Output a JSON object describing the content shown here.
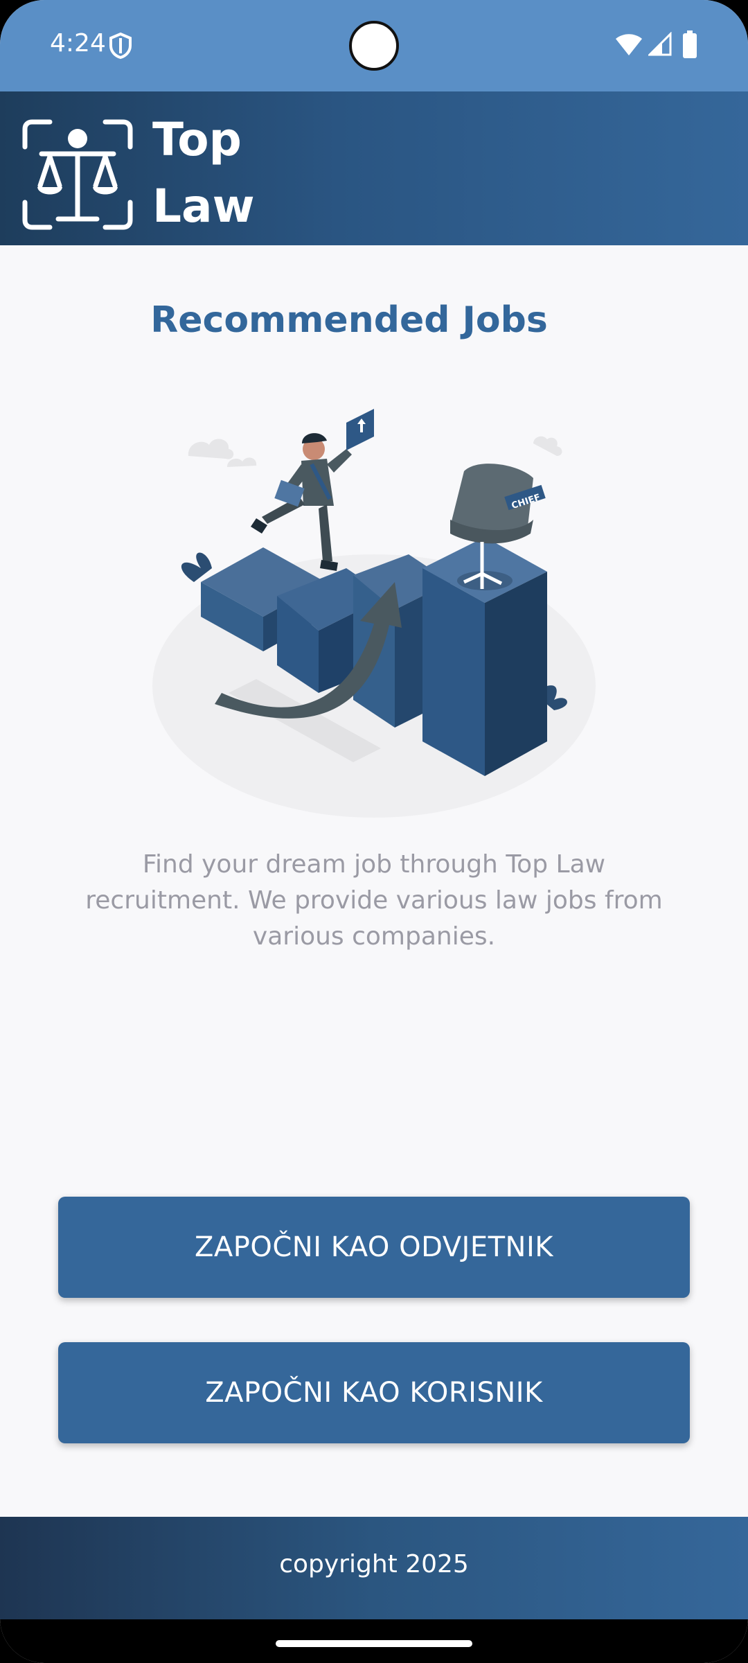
{
  "status_bar": {
    "time": "4:24",
    "icons": [
      "shield-icon",
      "wifi-icon",
      "signal-icon",
      "battery-icon"
    ]
  },
  "header": {
    "logo_icon": "scales-of-justice-icon",
    "title_line1": "Top",
    "title_line2": "Law",
    "gradient_start": "#1e3d5c",
    "gradient_end": "#35679a"
  },
  "main": {
    "title": "Recommended Jobs",
    "illustration": "career-growth-illustration",
    "description": "Find your dream job through Top Law recruitment. We provide various law jobs from various companies.",
    "chair_label": "CHIEF"
  },
  "buttons": {
    "lawyer_label": "ZAPOČNI KAO ODVJETNIK",
    "user_label": "ZAPOČNI KAO KORISNIK",
    "color": "#35679a"
  },
  "footer": {
    "text": "copyright 2025"
  },
  "colors": {
    "accent": "#33679b",
    "status_bar": "#5a8fc6",
    "background": "#f8f8fa",
    "description_text": "#9a9aa4"
  }
}
